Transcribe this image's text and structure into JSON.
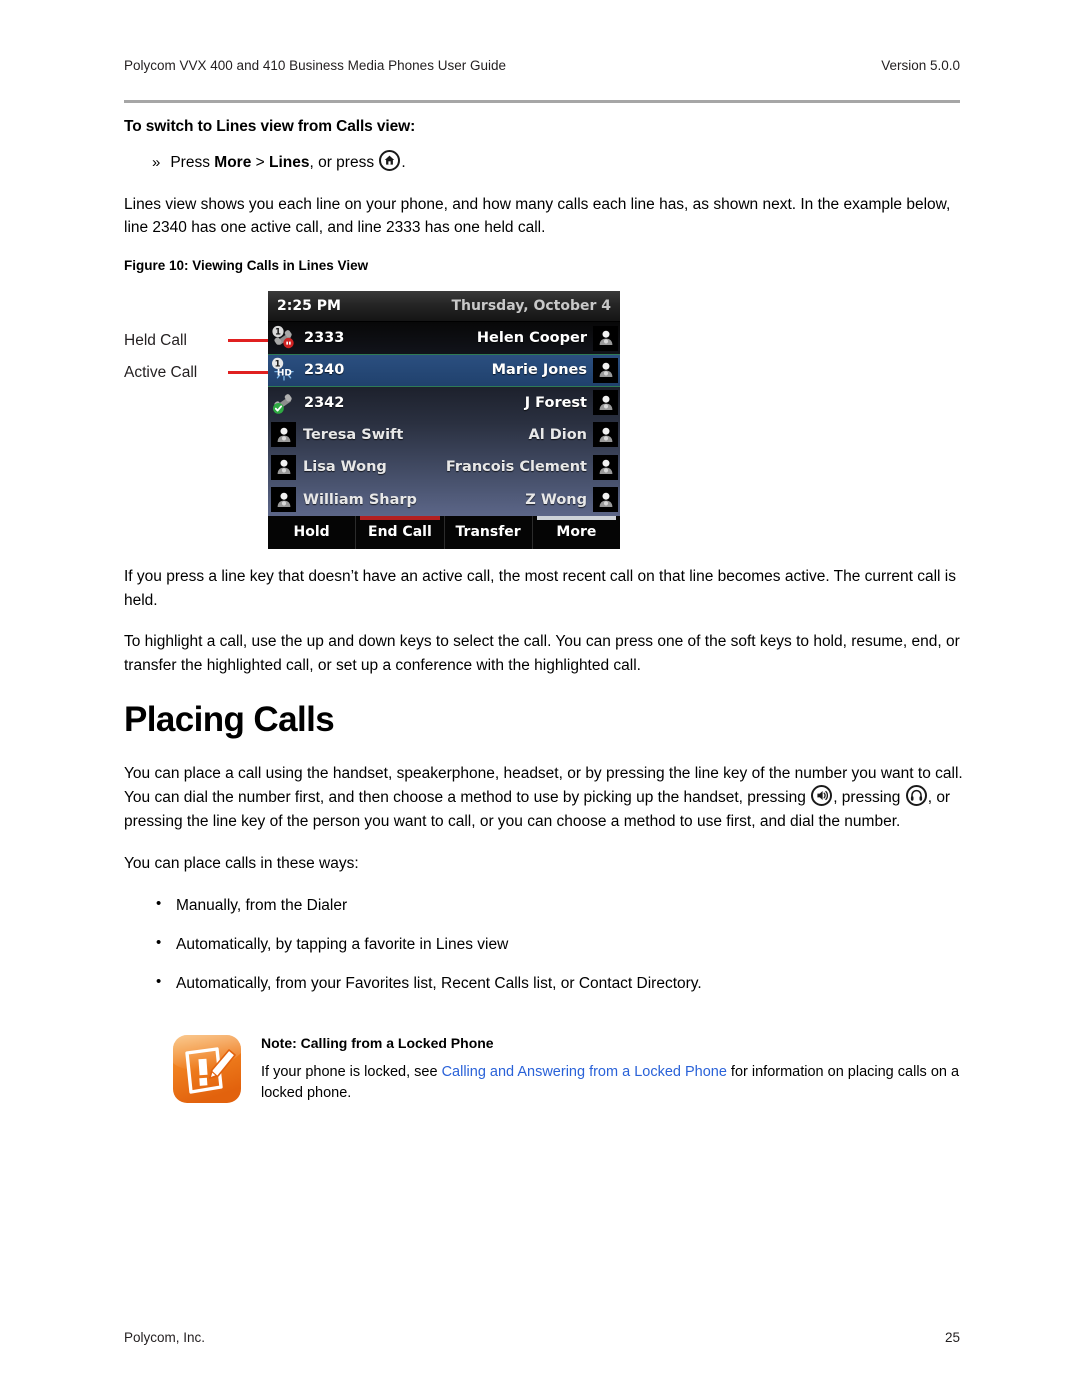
{
  "header": {
    "title": "Polycom VVX 400 and 410 Business Media Phones User Guide",
    "version": "Version 5.0.0"
  },
  "footer": {
    "company": "Polycom, Inc.",
    "page_number": "25"
  },
  "section": {
    "subhead": "To switch to Lines view from Calls view:",
    "step_marker": "»",
    "step_prefix": "Press ",
    "step_more": "More",
    "step_sep": " > ",
    "step_lines": "Lines",
    "step_suffix": ", or press ",
    "step_end": ".",
    "home_icon_name": "home-icon",
    "paragraph_1": "Lines view shows you each line on your phone, and how many calls each line has, as shown next. In the example below, line 2340 has one active call, and line 2333 has one held call.",
    "figure_caption": "Figure 10: Viewing Calls in Lines View",
    "paragraph_2": "If you press a line key that doesn’t have an active call, the most recent call on that line becomes active. The current call is held.",
    "paragraph_3": "To highlight a call, use the up and down keys to select the call. You can press one of the soft keys to hold, resume, end, or transfer the highlighted call, or set up a conference with the highlighted call."
  },
  "figure": {
    "callouts": [
      {
        "label": "Held Call"
      },
      {
        "label": "Active Call"
      }
    ],
    "callout_color": "#e02020",
    "phone": {
      "status_bar": {
        "time": "2:25 PM",
        "date": "Thursday, October 4"
      },
      "rows": [
        {
          "left_label": "2333",
          "right_label": "Helen Cooper",
          "left_icon": "held-call-handset-icon",
          "right_icon": "contact-avatar-icon",
          "badge": "1",
          "selected": false
        },
        {
          "left_label": "2340",
          "right_label": "Marie Jones",
          "left_icon": "hd-active-call-icon",
          "right_icon": "contact-avatar-icon",
          "badge": "1",
          "selected": true
        },
        {
          "left_label": "2342",
          "right_label": "J Forest",
          "left_icon": "registered-line-handset-icon",
          "right_icon": "contact-avatar-icon",
          "badge": "",
          "selected": false
        },
        {
          "left_label": "Teresa Swift",
          "right_label": "Al Dion",
          "left_icon": "contact-avatar-icon",
          "right_icon": "contact-avatar-icon",
          "badge": "",
          "selected": false
        },
        {
          "left_label": "Lisa Wong",
          "right_label": "Francois Clement",
          "left_icon": "contact-avatar-icon",
          "right_icon": "contact-avatar-icon",
          "badge": "",
          "selected": false
        },
        {
          "left_label": "William Sharp",
          "right_label": "Z Wong",
          "left_icon": "contact-avatar-icon",
          "right_icon": "contact-avatar-icon",
          "badge": "",
          "selected": false
        }
      ],
      "softkeys": [
        {
          "label": "Hold",
          "cap_color": "transparent"
        },
        {
          "label": "End Call",
          "cap_color": "#b32020"
        },
        {
          "label": "Transfer",
          "cap_color": "transparent"
        },
        {
          "label": "More",
          "cap_color": "#cdd2d8"
        }
      ]
    }
  },
  "chapter": {
    "title": "Placing Calls",
    "paragraph_a1": "You can place a call using the handset, speakerphone, headset, or by pressing the line key of the number you want to call. You can dial the number first, and then choose a method to use by picking up the handset, pressing ",
    "paragraph_a2": ", pressing ",
    "paragraph_a3": ", or pressing the line key of the person you want to call, or you can choose a method to use first, and dial the number.",
    "speaker_icon_name": "speakerphone-icon",
    "headset_icon_name": "headset-icon",
    "lead_in": "You can place calls in these ways:",
    "bullets": [
      "Manually, from the Dialer",
      "Automatically, by tapping a favorite in Lines view",
      "Automatically, from your Favorites list, Recent Calls list, or Contact Directory."
    ]
  },
  "note": {
    "icon_name": "note-pencil-icon",
    "accent_color": "#f08a2a",
    "title": "Note: Calling from a Locked Phone",
    "text_before": "If your phone is locked, see ",
    "link": "Calling and Answering from a Locked Phone",
    "text_after": " for information on placing calls on a locked phone.",
    "link_color": "#2a62d8"
  }
}
